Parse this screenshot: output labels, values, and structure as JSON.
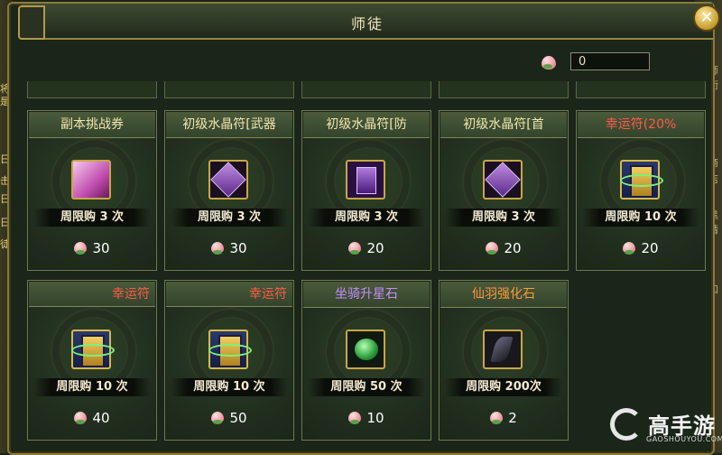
{
  "window": {
    "title": "师徒"
  },
  "currency": {
    "value": "0",
    "icon": "peach-icon"
  },
  "items": [
    {
      "name": "副本挑战券",
      "limit": "周限购 3 次",
      "price": "30",
      "name_color": "#f0e6b0",
      "icon": "scroll-icon"
    },
    {
      "name": "初级水晶符[武器",
      "limit": "周限购 3 次",
      "price": "30",
      "name_color": "#f0e6b0",
      "icon": "crystal-icon"
    },
    {
      "name": "初级水晶符[防",
      "limit": "周限购 3 次",
      "price": "20",
      "name_color": "#f0e6b0",
      "icon": "crystal-icon"
    },
    {
      "name": "初级水晶符[首",
      "limit": "周限购 3 次",
      "price": "20",
      "name_color": "#f0e6b0",
      "icon": "crystal-icon"
    },
    {
      "name": "幸运符(20%",
      "limit": "周限购 10 次",
      "price": "20",
      "name_color": "#ff5a4a",
      "icon": "charm-icon"
    },
    {
      "name": "幸运符",
      "limit": "周限购 10 次",
      "price": "40",
      "name_color": "#ff5a4a",
      "icon": "charm-icon"
    },
    {
      "name": "幸运符",
      "limit": "周限购 10 次",
      "price": "50",
      "name_color": "#ff5a4a",
      "icon": "charm-icon"
    },
    {
      "name": "坐骑升星石",
      "limit": "周限购 50 次",
      "price": "10",
      "name_color": "#c88cff",
      "icon": "gem-icon"
    },
    {
      "name": "仙羽强化石",
      "limit": "周限购 200次",
      "price": "2",
      "name_color": "#ff9a3a",
      "icon": "feather-icon"
    }
  ],
  "background": {
    "left_text": [
      "将",
      "是",
      "日",
      "击",
      "日",
      "日",
      "徒"
    ],
    "right_text": [
      "师",
      "衔",
      "商",
      "店",
      "黑",
      "请",
      "加"
    ]
  },
  "watermark": {
    "brand": "高手游",
    "url": "GAOSHOUYOU.COM"
  }
}
